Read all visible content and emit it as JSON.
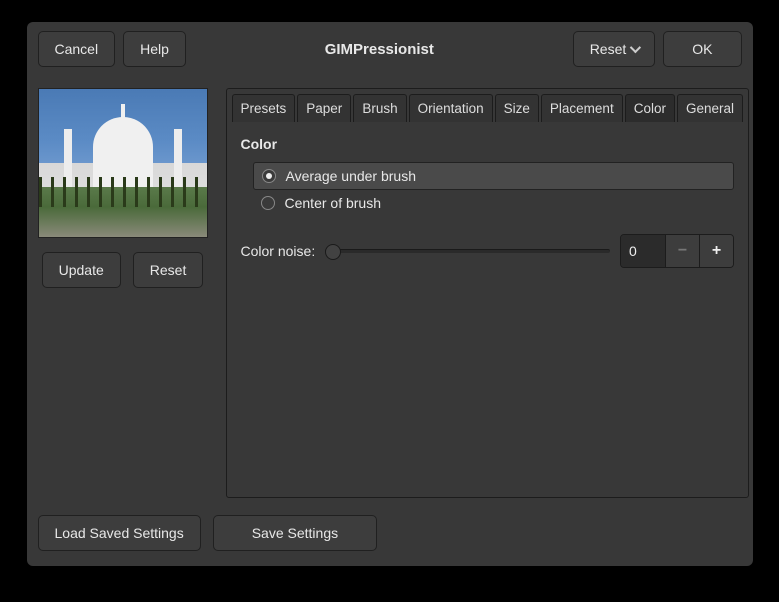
{
  "titlebar": {
    "cancel": "Cancel",
    "help": "Help",
    "title": "GIMPressionist",
    "reset": "Reset",
    "ok": "OK"
  },
  "preview": {
    "update": "Update",
    "reset": "Reset"
  },
  "tabs": {
    "presets": "Presets",
    "paper": "Paper",
    "brush": "Brush",
    "orientation": "Orientation",
    "size": "Size",
    "placement": "Placement",
    "color": "Color",
    "general": "General",
    "active": "color"
  },
  "color_panel": {
    "title": "Color",
    "opt_average": "Average under brush",
    "opt_center": "Center of brush",
    "noise_label": "Color noise:",
    "noise_value": "0"
  },
  "footer": {
    "load": "Load Saved Settings",
    "save": "Save Settings"
  }
}
